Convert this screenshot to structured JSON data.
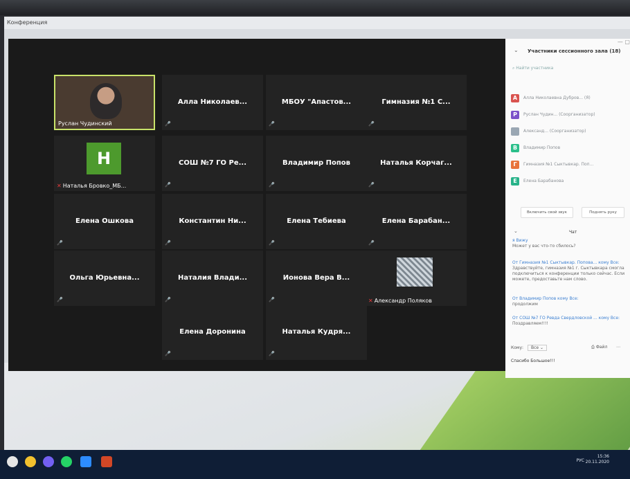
{
  "window": {
    "title": "Конференция"
  },
  "tiles": [
    {
      "name": "Руслан Чудинский",
      "kind": "video"
    },
    {
      "name": "Алла Николаев...",
      "kind": "text"
    },
    {
      "name": "МБОУ \"Апастов...",
      "kind": "text"
    },
    {
      "name": "Гимназия №1 С...",
      "kind": "text"
    },
    {
      "name": "Наталья Бровко_МБ...",
      "kind": "avatar",
      "avatar": "H"
    },
    {
      "name": "СОШ №7 ГО Ре...",
      "kind": "text"
    },
    {
      "name": "Владимир Попов",
      "kind": "text"
    },
    {
      "name": "Наталья Корчаг...",
      "kind": "text"
    },
    {
      "name": "Елена Ошкова",
      "kind": "text"
    },
    {
      "name": "Константин Ни...",
      "kind": "text"
    },
    {
      "name": "Елена Тебиева",
      "kind": "text"
    },
    {
      "name": "Елена Барабан...",
      "kind": "text"
    },
    {
      "name": "Ольга Юрьевна...",
      "kind": "text"
    },
    {
      "name": "Наталия Влади...",
      "kind": "text"
    },
    {
      "name": "Ионова Вера В...",
      "kind": "text"
    },
    {
      "name": "Александр Поляков",
      "kind": "image"
    },
    {
      "name": "Елена Доронина",
      "kind": "text"
    },
    {
      "name": "Наталья Кудря...",
      "kind": "text"
    }
  ],
  "panel": {
    "title": "Участники сессионного зала (18)",
    "search_placeholder": "Найти участника",
    "participants": [
      {
        "initial": "А",
        "color": "#d9534f",
        "name": "Алла Николаевна Дубров... (Я)"
      },
      {
        "initial": "P",
        "color": "#7b52c9",
        "name": "Руслан Чудин... (Соорганизатор)"
      },
      {
        "initial": "",
        "color": "#9aa7b3",
        "name": "Александ... (Соорганизатор)"
      },
      {
        "initial": "В",
        "color": "#2bbf8a",
        "name": "Владимир Попов"
      },
      {
        "initial": "Г",
        "color": "#e8733a",
        "name": "Гимназия №1 Сыктывкар. Поп..."
      },
      {
        "initial": "Е",
        "color": "#29b38a",
        "name": "Елена Барабанова"
      }
    ],
    "btn_unmute": "Включить свой звук",
    "btn_raise": "Поднять руку",
    "chat_title": "Чат",
    "chat": [
      {
        "from": "я Вижу",
        "msg": "Может у вас что-то сбилось?"
      },
      {
        "from": "От Гимназия №1 Сыктывкар. Попова... кому Все:",
        "msg": "Здравствуйте, гимназия №1 г. Сыктывкара смогла подключиться к конференции только сейчас. Если можете, предоставьте нам слово."
      },
      {
        "from": "От Владимир Попов кому Все:",
        "msg": "продолжим"
      },
      {
        "from": "От СОШ №7 ГО Ревда Свердловской ... кому Все:",
        "msg": "Поздравляем!!!!"
      }
    ],
    "to_label": "Кому:",
    "to_value": "Все",
    "file_label": "Файл",
    "composer_text": "Спасибо Большое!!!"
  },
  "taskbar": {
    "lang": "РУС",
    "time": "15:36",
    "date": "20.11.2020"
  }
}
